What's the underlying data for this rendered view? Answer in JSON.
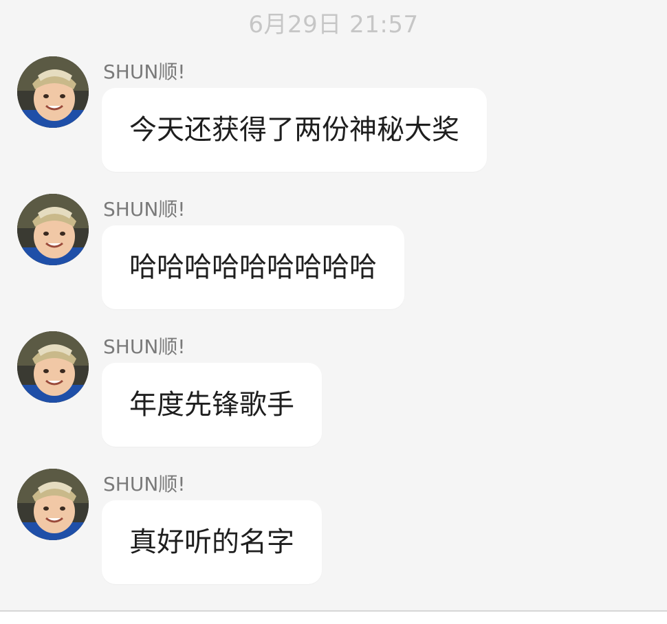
{
  "timestamp": "6月29日 21:57",
  "messages": [
    {
      "sender": "SHUN顺!",
      "text": "今天还获得了两份神秘大奖"
    },
    {
      "sender": "SHUN顺!",
      "text": "哈哈哈哈哈哈哈哈哈"
    },
    {
      "sender": "SHUN顺!",
      "text": "年度先锋歌手"
    },
    {
      "sender": "SHUN顺!",
      "text": "真好听的名字"
    }
  ],
  "colors": {
    "background": "#f5f5f5",
    "bubble": "#ffffff",
    "sender_text": "#7a7a7a",
    "message_text": "#1e1e1e",
    "timestamp_text": "#c6c6c6"
  },
  "icons": {
    "avatar": "user-avatar-photo"
  }
}
